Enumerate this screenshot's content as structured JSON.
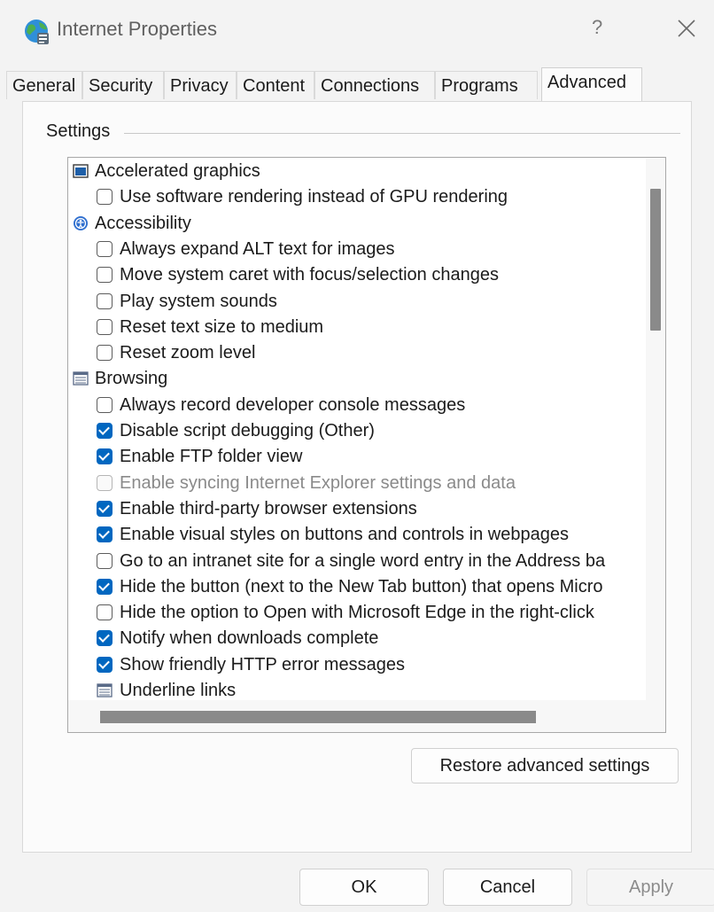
{
  "window": {
    "title": "Internet Properties",
    "help_label": "?",
    "icon": "globe-icon"
  },
  "tabs": [
    {
      "label": "General"
    },
    {
      "label": "Security"
    },
    {
      "label": "Privacy"
    },
    {
      "label": "Content"
    },
    {
      "label": "Connections"
    },
    {
      "label": "Programs"
    },
    {
      "label": "Advanced",
      "active": true
    }
  ],
  "settings": {
    "group_label": "Settings",
    "items": [
      {
        "kind": "category",
        "label": "Accelerated graphics",
        "icon": "monitor-icon"
      },
      {
        "kind": "option",
        "label": "Use software rendering instead of GPU rendering",
        "checked": false
      },
      {
        "kind": "category",
        "label": "Accessibility",
        "icon": "accessibility-icon"
      },
      {
        "kind": "option",
        "label": "Always expand ALT text for images",
        "checked": false
      },
      {
        "kind": "option",
        "label": "Move system caret with focus/selection changes",
        "checked": false
      },
      {
        "kind": "option",
        "label": "Play system sounds",
        "checked": false
      },
      {
        "kind": "option",
        "label": "Reset text size to medium",
        "checked": false
      },
      {
        "kind": "option",
        "label": "Reset zoom level",
        "checked": false
      },
      {
        "kind": "category",
        "label": "Browsing",
        "icon": "list-icon"
      },
      {
        "kind": "option",
        "label": "Always record developer console messages",
        "checked": false
      },
      {
        "kind": "option",
        "label": "Disable script debugging (Other)",
        "checked": true
      },
      {
        "kind": "option",
        "label": "Enable FTP folder view",
        "checked": true
      },
      {
        "kind": "option",
        "label": "Enable syncing Internet Explorer settings and data",
        "checked": false,
        "disabled": true
      },
      {
        "kind": "option",
        "label": "Enable third-party browser extensions",
        "checked": true
      },
      {
        "kind": "option",
        "label": "Enable visual styles on buttons and controls in webpages",
        "checked": true
      },
      {
        "kind": "option",
        "label": "Go to an intranet site for a single word entry in the Address ba",
        "checked": false
      },
      {
        "kind": "option",
        "label": "Hide the button (next to the New Tab button) that opens Micro",
        "checked": true
      },
      {
        "kind": "option",
        "label": "Hide the option to Open with Microsoft Edge in the right-click",
        "checked": false
      },
      {
        "kind": "option",
        "label": "Notify when downloads complete",
        "checked": true
      },
      {
        "kind": "option",
        "label": "Show friendly HTTP error messages",
        "checked": true
      },
      {
        "kind": "sub",
        "label": "Underline links",
        "icon": "list-icon"
      }
    ],
    "restore_label": "Restore advanced settings"
  },
  "footer": {
    "ok_label": "OK",
    "cancel_label": "Cancel",
    "apply_label": "Apply"
  },
  "colors": {
    "accent": "#0067c0"
  }
}
